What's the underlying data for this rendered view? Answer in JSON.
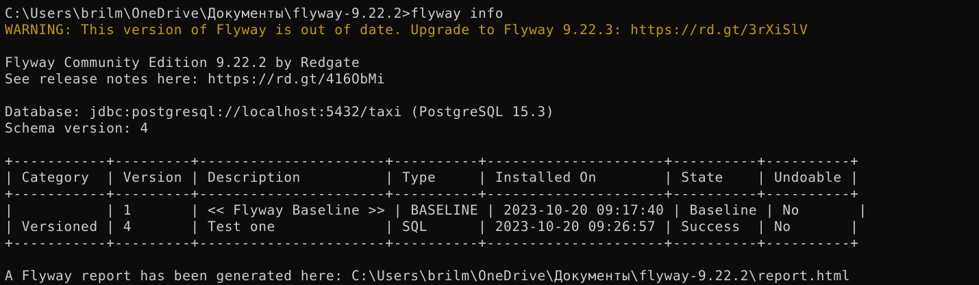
{
  "terminal": {
    "prompt": "C:\\Users\\brilm\\OneDrive\\Документы\\flyway-9.22.2>",
    "command": "flyway info",
    "warning": "WARNING: This version of Flyway is out of date. Upgrade to Flyway 9.22.3: https://rd.gt/3rXiSlV",
    "edition": "Flyway Community Edition 9.22.2 by Redgate",
    "release_notes": "See release notes here: https://rd.gt/416ObMi",
    "database": "Database: jdbc:postgresql://localhost:5432/taxi (PostgreSQL 15.3)",
    "schema_version": "Schema version: 4",
    "table": {
      "border": "+-----------+---------+----------------------+----------+---------------------+----------+----------+",
      "header": "| Category  | Version | Description          | Type     | Installed On        | State    | Undoable |",
      "rows": [
        "|           | 1       | << Flyway Baseline >> | BASELINE | 2023-10-20 09:17:40 | Baseline | No       |",
        "| Versioned | 4       | Test one             | SQL      | 2023-10-20 09:26:57 | Success  | No       |"
      ]
    },
    "report": "A Flyway report has been generated here: C:\\Users\\brilm\\OneDrive\\Документы\\flyway-9.22.2\\report.html"
  },
  "colors": {
    "background": "#0c0c0c",
    "text": "#cccccc",
    "warning": "#c19c00"
  }
}
